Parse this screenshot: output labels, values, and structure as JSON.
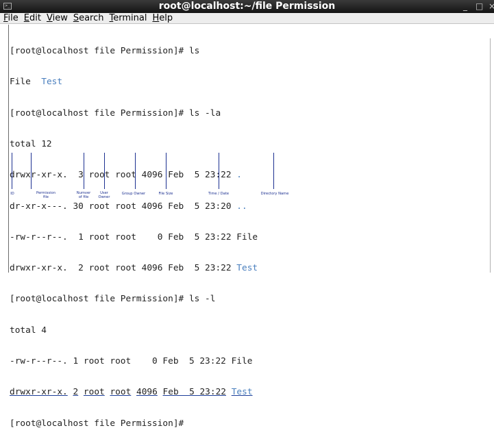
{
  "window": {
    "title": "root@localhost:~/file Permission",
    "minimize": "_",
    "maximize": "□",
    "close": "×"
  },
  "menu": [
    "File",
    "Edit",
    "View",
    "Search",
    "Terminal",
    "Help"
  ],
  "terminal": {
    "line1": "[root@localhost file Permission]# ls",
    "ls_file": "File",
    "ls_test": "Test",
    "line3": "[root@localhost file Permission]# ls -la",
    "line4": "total 12",
    "la_row1_pre": "drwxr-xr-x.  3 root root 4096 Feb  5 23:22 ",
    "la_row1_name": ".",
    "la_row2_pre": "dr-xr-x---. 30 root root 4096 Feb  5 23:20 ",
    "la_row2_name": "..",
    "la_row3": "-rw-r--r--.  1 root root    0 Feb  5 23:22 File",
    "la_row4_pre": "drwxr-xr-x.  2 root root 4096 Feb  5 23:22 ",
    "la_row4_name": "Test",
    "line9": "[root@localhost file Permission]# ls -l",
    "line10": "total 4",
    "l_row1": "-rw-r--r--. 1 root root    0 Feb  5 23:22 File",
    "l_row2": {
      "perm": "drwxr-xr-x.",
      "links": "2",
      "user": "root",
      "group": "root",
      "size": "4096",
      "date": "Feb  5 23:22",
      "name": "Test"
    },
    "prompt": "[root@localhost file Permission]#"
  },
  "annotations": {
    "id": "ID",
    "permission": "Permission\nfile",
    "number": "Numver\nof file",
    "user": "User\nOwner",
    "group": "Group Owner",
    "filesize": "File Size",
    "time": "Time / Date",
    "dirname": "Directory Name"
  }
}
